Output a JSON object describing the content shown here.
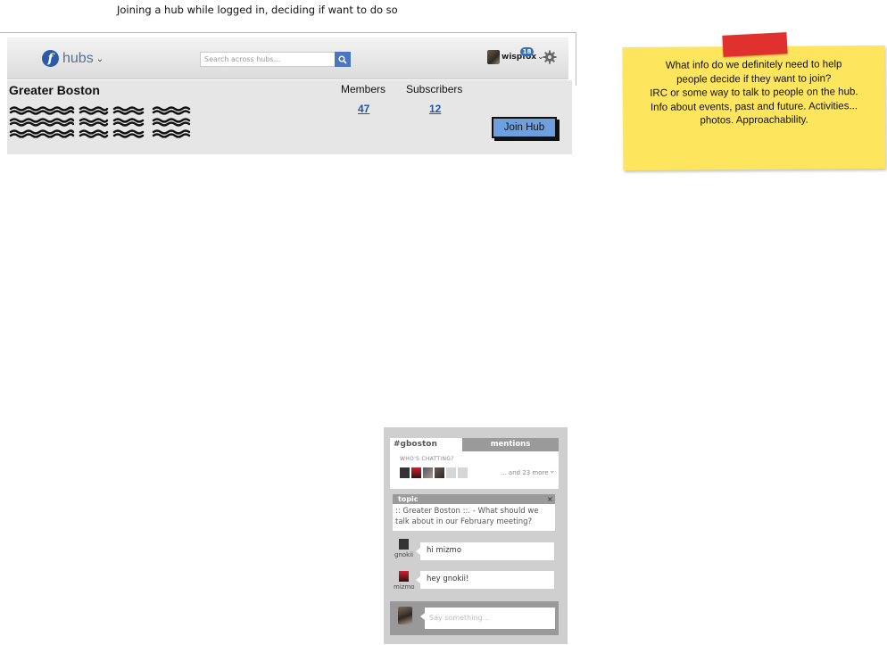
{
  "caption": "Joining a hub while logged in, deciding if want to do so",
  "header": {
    "logo_text": "hubs",
    "logo_chevron": "⌄",
    "search_placeholder": "Search across hubs...",
    "search_icon": "magnifier-icon",
    "username": "wispfox",
    "user_chevron": "⌄",
    "notification_count": "18",
    "settings_icon": "gear-icon"
  },
  "hub": {
    "name": "Greater Boston",
    "members_label": "Members",
    "subscribers_label": "Subscribers",
    "members_count": "47",
    "subscribers_count": "12",
    "join_label": "Join Hub"
  },
  "sticky_note": {
    "lines": [
      "What info do we definitely need to help",
      "people decide if they want to join?",
      "IRC or some way to talk to people on the hub.",
      "Info about events, past and future. Activities...",
      "photos. Approachability."
    ]
  },
  "chat": {
    "tab_active": "#gboston",
    "tab_mentions": "mentions",
    "whos_chatting_label": "WHO'S CHATTING?",
    "more_text": "... and 23 more",
    "topic_label": "topic",
    "topic_close": "×",
    "topic_text": ":: Greater Boston ::.  - What should we talk about in our February meeting?",
    "messages": [
      {
        "nick": "gnokii",
        "text": "hi mizmo"
      },
      {
        "nick": "mizmo",
        "text": "hey gnokii!"
      }
    ],
    "input_placeholder": "Say something..."
  },
  "colors": {
    "accent_blue": "#4a76c1",
    "join_button": "#6ea0de",
    "sticky": "#fde55e",
    "tape": "#e0312f"
  }
}
